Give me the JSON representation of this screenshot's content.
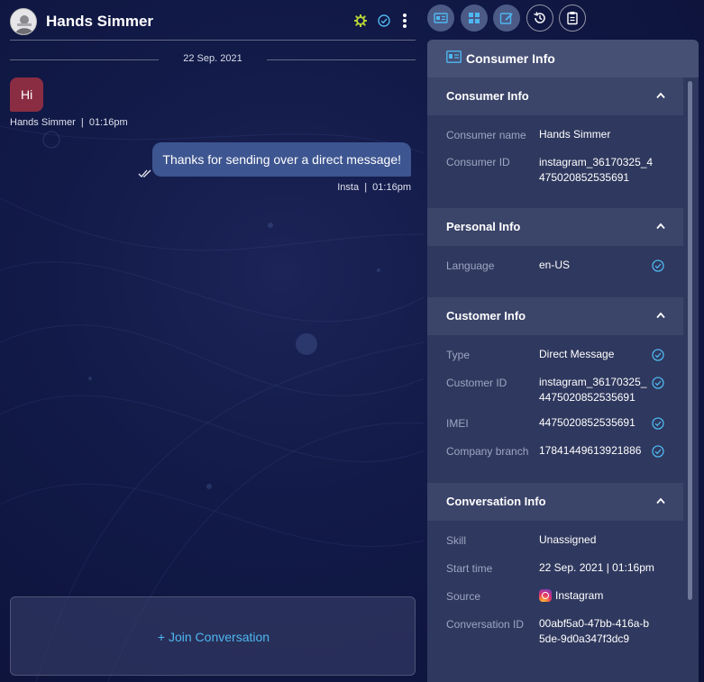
{
  "chat": {
    "contact_name": "Hands Simmer",
    "date_divider": "22 Sep. 2021",
    "messages": [
      {
        "text": "Hi",
        "meta": "Hands Simmer  |  01:16pm"
      },
      {
        "text": "Thanks for sending over a direct message!",
        "meta": "Insta  |  01:16pm"
      }
    ],
    "join_label": "+ Join Conversation"
  },
  "panel": {
    "title": "Consumer Info",
    "sections": [
      {
        "title": "Consumer Info",
        "rows": [
          {
            "label": "Consumer name",
            "value": "Hands Simmer"
          },
          {
            "label": "Consumer ID",
            "value": "instagram_36170325_4475020852535691"
          }
        ]
      },
      {
        "title": "Personal Info",
        "rows": [
          {
            "label": "Language",
            "value": "en-US"
          }
        ]
      },
      {
        "title": "Customer Info",
        "rows": [
          {
            "label": "Type",
            "value": "Direct Message"
          },
          {
            "label": "Customer ID",
            "value": "instagram_36170325_4475020852535691"
          },
          {
            "label": "IMEI",
            "value": "4475020852535691"
          },
          {
            "label": "Company branch",
            "value": "17841449613921886"
          }
        ]
      },
      {
        "title": "Conversation Info",
        "rows": [
          {
            "label": "Skill",
            "value": "Unassigned"
          },
          {
            "label": "Start time",
            "value": "22 Sep. 2021 | 01:16pm"
          },
          {
            "label": "Source",
            "value": "Instagram"
          },
          {
            "label": "Conversation ID",
            "value": "00abf5a0-47bb-416a-b5de-9d0a347f3dc9"
          }
        ]
      }
    ]
  },
  "toolbar": {
    "icons": [
      "id-card-icon",
      "network-icon",
      "edit-icon",
      "history-icon",
      "clipboard-icon"
    ]
  },
  "colors": {
    "accent": "#4fb7f0",
    "incoming_bubble": "#8a2d43",
    "outgoing_bubble": "#3d5590",
    "panel_bg": "#2f385e"
  }
}
